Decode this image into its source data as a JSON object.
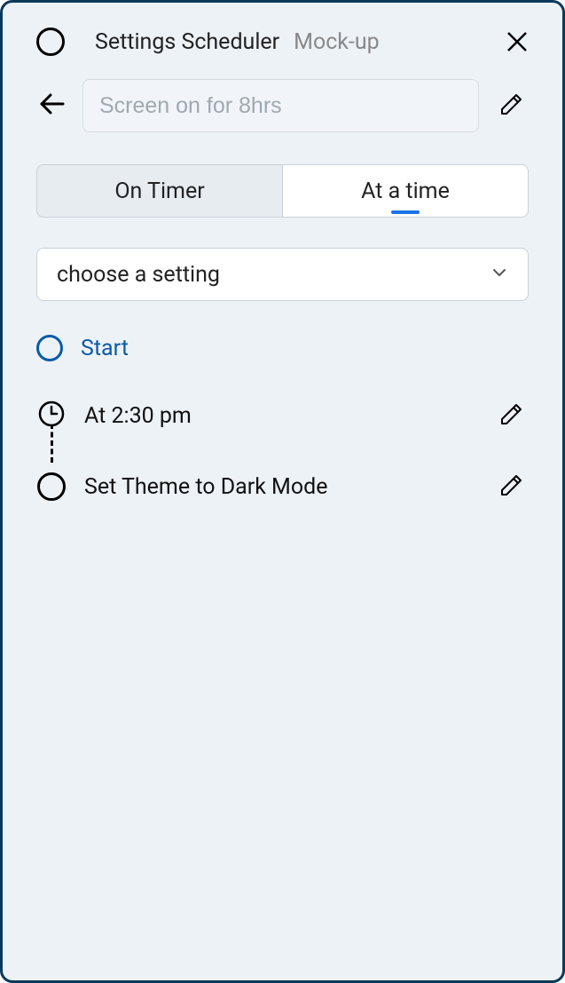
{
  "header": {
    "title": "Settings Scheduler",
    "subtitle": "Mock-up"
  },
  "input": {
    "placeholder": "Screen on for 8hrs",
    "value": ""
  },
  "tabs": {
    "on_timer_label": "On Timer",
    "at_a_time_label": "At a time",
    "active": "at_a_time"
  },
  "setting_select": {
    "placeholder": "choose a setting"
  },
  "start_label": "Start",
  "timeline": {
    "time_label": "At 2:30 pm",
    "action_label": "Set Theme to Dark Mode"
  }
}
